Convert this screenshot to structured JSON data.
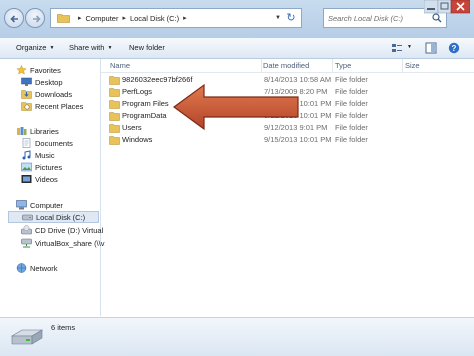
{
  "address": {
    "crumbs": [
      "Computer",
      "Local Disk (C:)"
    ]
  },
  "search": {
    "placeholder": "Search Local Disk (C:)"
  },
  "toolbar": {
    "organize": "Organize",
    "share_with": "Share with",
    "new_folder": "New folder"
  },
  "nav": {
    "favorites": "Favorites",
    "desktop": "Desktop",
    "downloads": "Downloads",
    "recent_places": "Recent Places",
    "libraries": "Libraries",
    "documents": "Documents",
    "music": "Music",
    "pictures": "Pictures",
    "videos": "Videos",
    "computer": "Computer",
    "local_disk": "Local Disk (C:)",
    "cd_drive": "CD Drive (D:) Virtual",
    "virtualbox_share": "VirtualBox_share (\\\\v",
    "network": "Network"
  },
  "columns": {
    "name": "Name",
    "date": "Date modified",
    "type": "Type",
    "size": "Size"
  },
  "files": [
    {
      "name": "9826032eec97bf266f",
      "date": "8/14/2013 10:58 AM",
      "type": "File folder"
    },
    {
      "name": "PerfLogs",
      "date": "7/13/2009 8:20 PM",
      "type": "File folder"
    },
    {
      "name": "Program Files",
      "date": "9/15/2013 10:01 PM",
      "type": "File folder"
    },
    {
      "name": "ProgramData",
      "date": "9/12/2013 10:01 PM",
      "type": "File folder"
    },
    {
      "name": "Users",
      "date": "9/12/2013 9:01 PM",
      "type": "File folder"
    },
    {
      "name": "Windows",
      "date": "9/15/2013 10:01 PM",
      "type": "File folder"
    }
  ],
  "status": {
    "count": "6 items"
  },
  "colors": {
    "arrow": "#c0502a",
    "folder": "#e8c35a"
  }
}
